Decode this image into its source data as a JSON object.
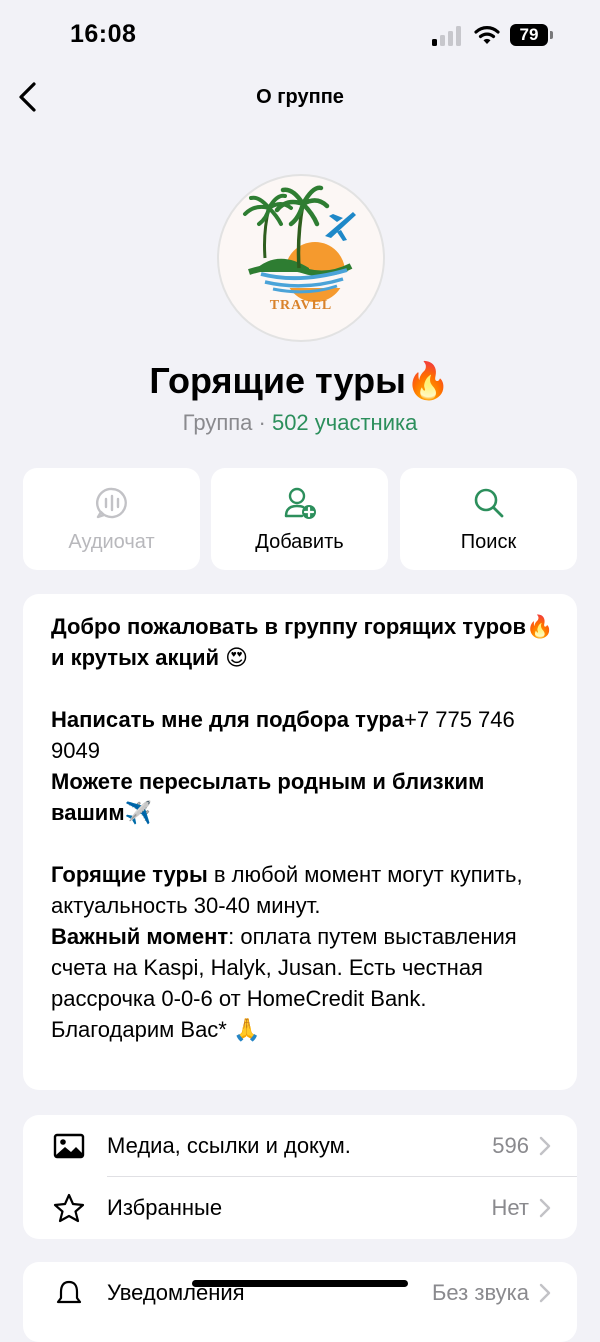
{
  "status_bar": {
    "time": "16:08",
    "battery": "79"
  },
  "nav": {
    "title": "О группе"
  },
  "group": {
    "name": "Горящие туры🔥",
    "type_prefix": "Группа · ",
    "members": "502 участника",
    "avatar_text": "TRAVEL"
  },
  "actions": [
    {
      "label": "Аудиочат",
      "enabled": false,
      "icon": "audio-chat-icon"
    },
    {
      "label": "Добавить",
      "enabled": true,
      "icon": "add-user-icon"
    },
    {
      "label": "Поиск",
      "enabled": true,
      "icon": "search-icon"
    }
  ],
  "description": {
    "p1_bold": "Добро пожаловать в группу горящих туров🔥и крутых акций 😍",
    "p2_bold": "Написать мне для подбора тура",
    "p2_phone": "+7 775 746 9049",
    "p3_bold": "Можете пересылать родным и близким вашим✈️",
    "p4_bold": "Горящие туры",
    "p4_rest": " в любой момент могут купить, актуальность 30-40 минут.",
    "p5_bold": "Важный момент",
    "p5_rest": ": оплата путем выставления счета на Kaspi, Halyk, Jusan. Есть честная рассрочка 0-0-6 от HomeCredit Bank.",
    "p6": "Благодарим Вас* 🙏"
  },
  "list": [
    {
      "label": "Медиа, ссылки и докум.",
      "value": "596",
      "icon": "photo-icon"
    },
    {
      "label": "Избранные",
      "value": "Нет",
      "icon": "star-icon"
    }
  ],
  "list2": [
    {
      "label": "Уведомления",
      "value": "Без звука",
      "icon": "bell-icon"
    }
  ]
}
